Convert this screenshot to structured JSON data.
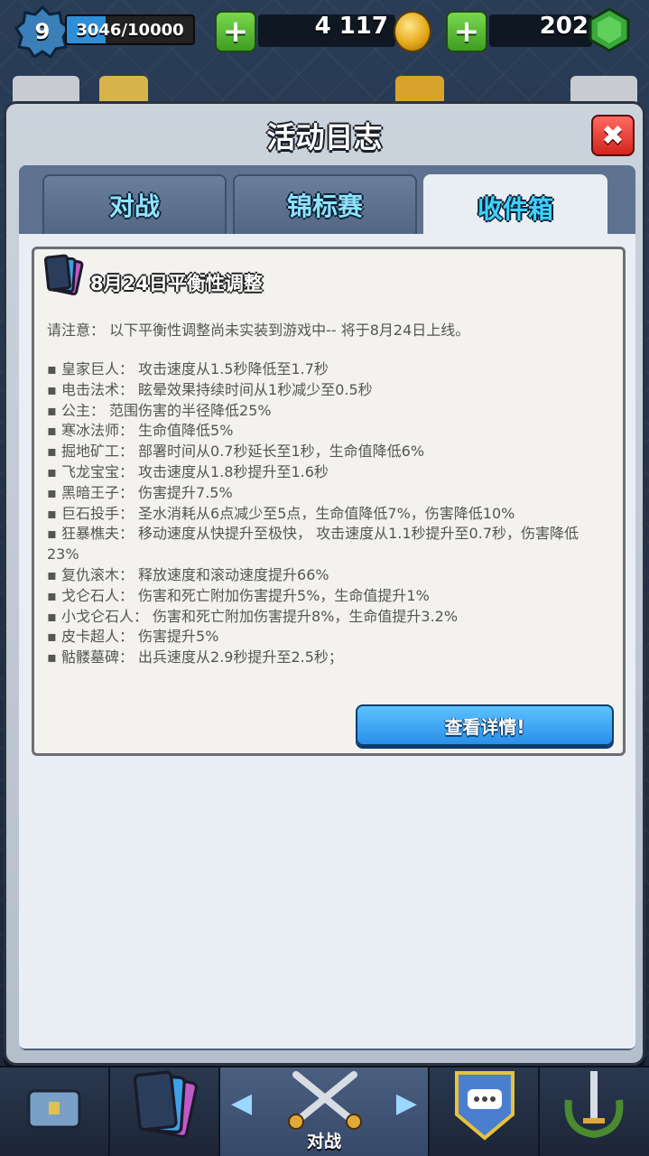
{
  "top_bar": {
    "level": "9",
    "xp_text": "3046/10000",
    "xp_progress": 0.3046,
    "gold": "4 117",
    "gems": "202",
    "plus_label": "+"
  },
  "modal": {
    "title": "活动日志",
    "close_label": "✖",
    "tabs": [
      {
        "label": "对战"
      },
      {
        "label": "锦标赛"
      },
      {
        "label": "收件箱"
      }
    ],
    "active_tab": 2
  },
  "message": {
    "title": "8月24日平衡性调整",
    "notice": "请注意：  以下平衡性调整尚未实装到游戏中-- 将于8月24日上线。",
    "items": [
      "皇家巨人：  攻击速度从1.5秒降低至1.7秒",
      "电击法术：  眩晕效果持续时间从1秒减少至0.5秒",
      "公主：  范围伤害的半径降低25%",
      "寒冰法师：  生命值降低5%",
      "掘地矿工：   部署时间从0.7秒延长至1秒，生命值降低6%",
      "飞龙宝宝：  攻击速度从1.8秒提升至1.6秒",
      "黑暗王子：  伤害提升7.5%",
      "巨石投手：  圣水消耗从6点减少至5点，生命值降低7%，伤害降低10%",
      "狂暴樵夫：  移动速度从快提升至极快，  攻击速度从1.1秒提升至0.7秒，伤害降低23%",
      "复仇滚木：  释放速度和滚动速度提升66%",
      "戈仑石人：  伤害和死亡附加伤害提升5%，生命值提升1%",
      "小戈仑石人：  伤害和死亡附加伤害提升8%，生命值提升3.2%",
      "皮卡超人：  伤害提升5%",
      "骷髅墓碑：  出兵速度从2.9秒提升至2.5秒；"
    ],
    "details_button": "查看详情!"
  },
  "bottom_nav": {
    "battle_label": "对战",
    "icons": [
      "shop-chest-icon",
      "cards-icon",
      "battle-swords-icon",
      "clan-chat-icon",
      "tournament-sword-icon"
    ]
  },
  "colors": {
    "tab_text": "#8fe3ff",
    "button_blue": "#2a8fe8",
    "close_red": "#d1241c",
    "plus_green": "#3f9e22"
  }
}
